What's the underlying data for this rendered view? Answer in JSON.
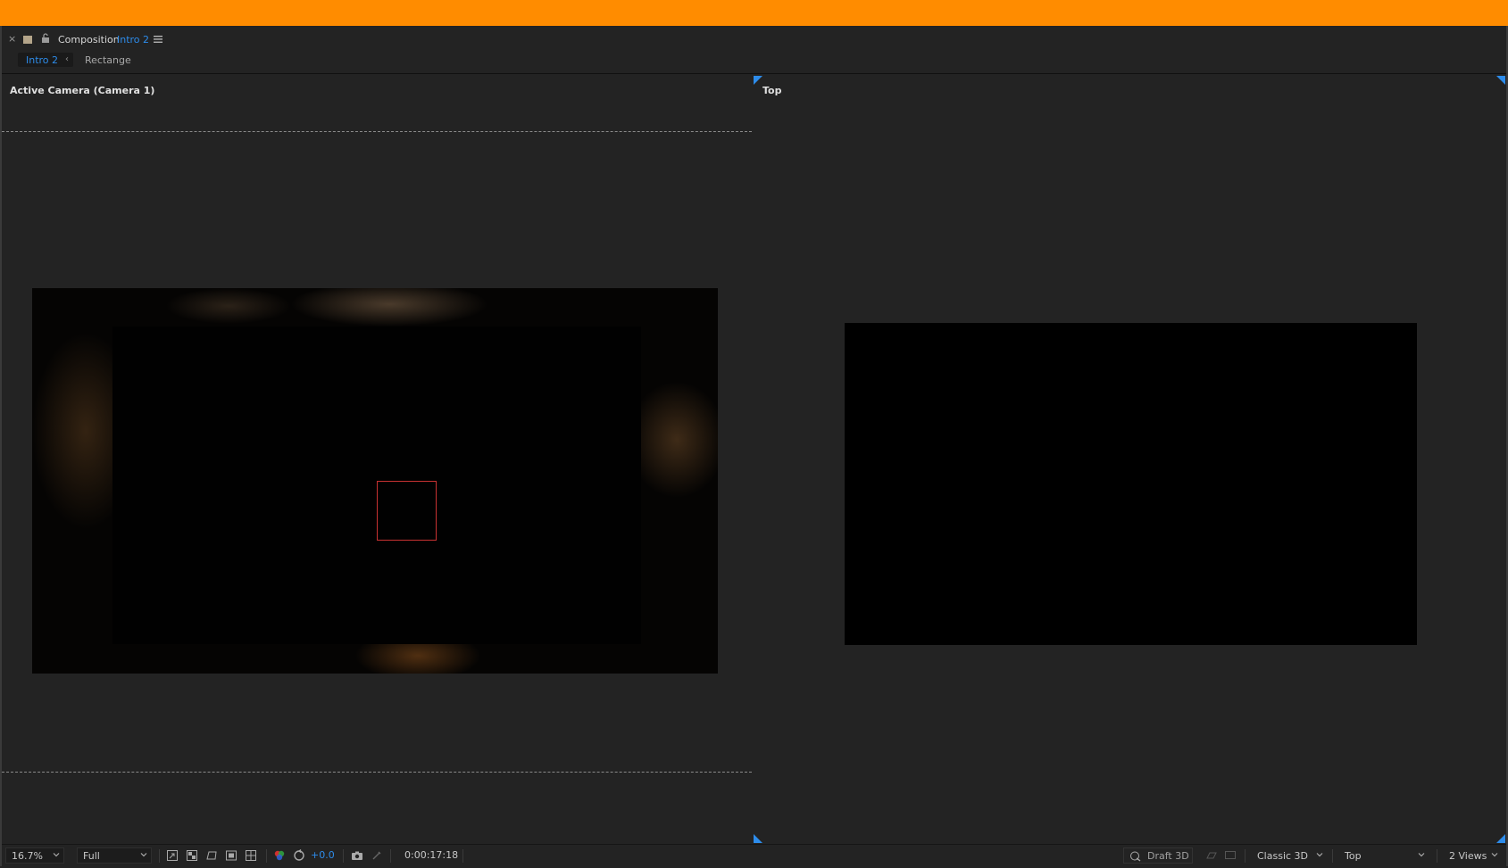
{
  "panel": {
    "close_glyph": "×",
    "composition_label": "Composition",
    "composition_name": "Intro 2",
    "swatch_color": "#b4a58a",
    "accent_color": "#2d8ceb"
  },
  "tabs": [
    {
      "label": "Intro 2",
      "active": true
    },
    {
      "label": "Rectange",
      "active": false
    }
  ],
  "viewers": {
    "left_label": "Active Camera (Camera 1)",
    "right_label": "Top"
  },
  "toolbar": {
    "zoom": "16.7%",
    "resolution": "Full",
    "exposure": "+0.0",
    "timecode": "0:00:17:18",
    "renderer_button": "Draft 3D",
    "renderer": "Classic 3D",
    "view": "Top",
    "view_layout": "2 Views"
  },
  "icons": [
    "close-icon",
    "lock-icon",
    "menu-icon",
    "chevron-left-icon",
    "region-of-interest-icon",
    "transparency-grid-icon",
    "mask-visibility-icon",
    "toggle-guides-icon",
    "grid-icon",
    "channel-icon",
    "reset-exposure-icon",
    "camera-snapshot-icon",
    "show-snapshot-icon",
    "draft-3d-icon",
    "3d-ground-plane-icon",
    "extended-viewer-icon",
    "chevron-down-icon"
  ]
}
